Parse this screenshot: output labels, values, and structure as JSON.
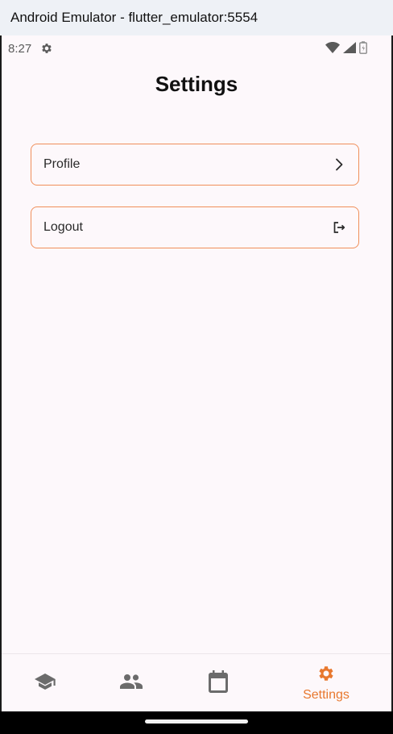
{
  "window": {
    "title": "Android Emulator - flutter_emulator:5554"
  },
  "status_bar": {
    "time": "8:27",
    "icons": [
      "gear-icon",
      "wifi-icon",
      "cellular-signal-icon",
      "battery-icon"
    ]
  },
  "page": {
    "title": "Settings"
  },
  "settings_items": [
    {
      "label": "Profile",
      "icon": "chevron-right-icon"
    },
    {
      "label": "Logout",
      "icon": "logout-icon"
    }
  ],
  "bottom_nav": {
    "items": [
      {
        "icon": "school-icon",
        "label": "",
        "selected": false
      },
      {
        "icon": "people-icon",
        "label": "",
        "selected": false
      },
      {
        "icon": "calendar-icon",
        "label": "",
        "selected": false
      },
      {
        "icon": "gear-icon",
        "label": "Settings",
        "selected": true
      }
    ]
  },
  "colors": {
    "accent": "#e8782e",
    "row_border": "#f08f5a",
    "background": "#fdf8fb",
    "inactive_icon": "#6b6b6b"
  }
}
